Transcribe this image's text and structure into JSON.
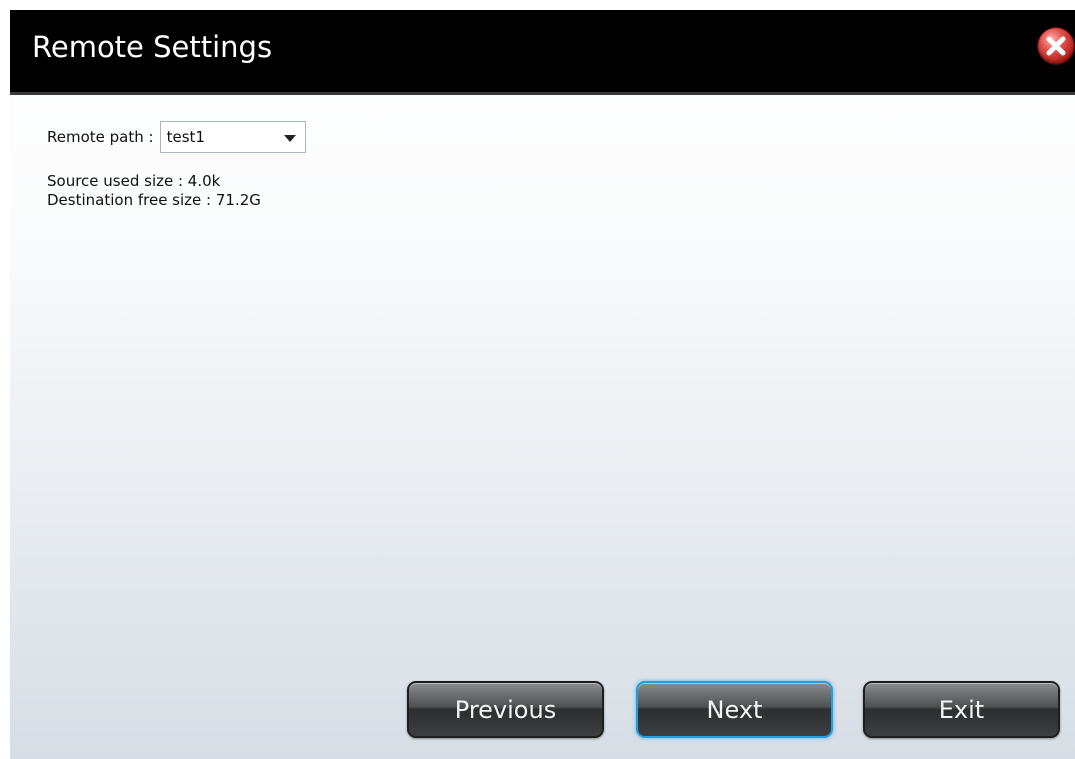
{
  "dialog": {
    "title": "Remote Settings",
    "close_icon": "close-x-icon"
  },
  "remote_path": {
    "label": "Remote path :",
    "selected": "test1"
  },
  "info": {
    "source_used": "Source used size : 4.0k",
    "destination_free": "Destination free size : 71.2G"
  },
  "buttons": {
    "previous": "Previous",
    "next": "Next",
    "exit": "Exit"
  },
  "colors": {
    "titlebar": "#000000",
    "close": "#c8241f",
    "next_highlight": "#2b9ad8"
  }
}
